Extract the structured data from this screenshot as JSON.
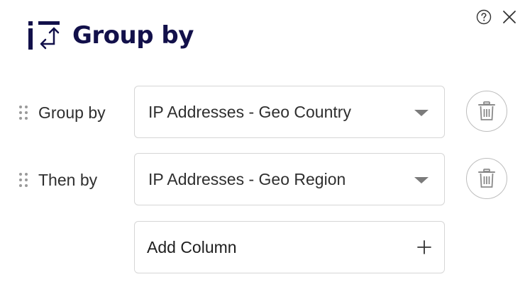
{
  "dialog": {
    "title": "Group by",
    "help_icon": "question-circle-icon",
    "close_icon": "close-icon",
    "title_icon": "group-by-icon"
  },
  "rows": [
    {
      "label": "Group by",
      "value": "IP Addresses - Geo Country"
    },
    {
      "label": "Then by",
      "value": "IP Addresses - Geo Region"
    }
  ],
  "add_column": {
    "label": "Add Column"
  },
  "colors": {
    "title": "#12104a",
    "border": "#d6d6d6",
    "icon": "#6b6b6b"
  }
}
